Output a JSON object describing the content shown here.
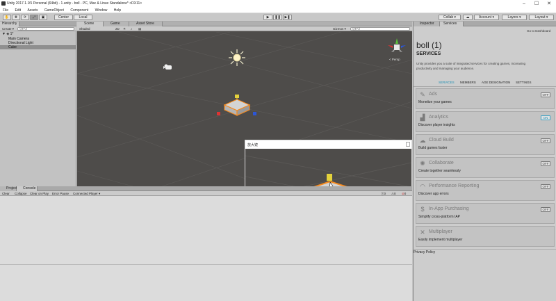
{
  "window": {
    "title": "Unity 2017.1.1f1 Personal (64bit) - 1.unity - boll - PC, Mac & Linux Standalone* <DX11>",
    "minimize": "–",
    "maximize": "☐",
    "close": "✕"
  },
  "menu": [
    "File",
    "Edit",
    "Assets",
    "GameObject",
    "Component",
    "Window",
    "Help"
  ],
  "toolbar": {
    "center": "Center",
    "local": "Local",
    "play": "▶",
    "pause": "❚❚",
    "step": "▶❚",
    "collab": "Collab ▾",
    "account": "Account ▾",
    "layers": "Layers ▾",
    "layout": "Layout ▾"
  },
  "hierarchy": {
    "tab": "Hierarchy",
    "create": "Create ▾",
    "search_placeholder": "Q▾All",
    "scene_name": "1*",
    "items": [
      "Main Camera",
      "Directional Light",
      "Cube"
    ]
  },
  "scene": {
    "tabs": [
      "Scene",
      "Game",
      "Asset Store"
    ],
    "shading": "Shaded",
    "mode2d": "2D",
    "gizmos": "Gizmos ▾",
    "search_placeholder": "Q▾All",
    "persp": "< Persp",
    "magnifier_title": "放大镜"
  },
  "console": {
    "tabs": [
      "Project",
      "Console"
    ],
    "buttons": [
      "Clear",
      "Collapse",
      "Clear on Play",
      "Error Pause",
      "Connected Player ▾"
    ],
    "counts": [
      "0",
      "0",
      "0"
    ]
  },
  "inspector": {
    "tabs": [
      "Inspector",
      "Services"
    ],
    "dashboard": "Go to Dashboard",
    "project_name": "boll (1)",
    "heading": "SERVICES",
    "intro_line1": "Unity provides you a suite of integrated services for creating games, increasing",
    "intro_line2": "productivity and managing your audience.",
    "subtabs": [
      "SERVICES",
      "MEMBERS",
      "AGE DESIGNATION",
      "SETTINGS"
    ],
    "services": [
      {
        "name": "Ads",
        "desc": "Monetize your games",
        "toggle": "OFF",
        "icon": "ads-icon",
        "glyph": "✎"
      },
      {
        "name": "Analytics",
        "desc": "Discover player insights",
        "toggle": "ON",
        "icon": "analytics-icon",
        "glyph": "▟"
      },
      {
        "name": "Cloud Build",
        "desc": "Build games faster",
        "toggle": "OFF",
        "icon": "cloud-icon",
        "glyph": "☁"
      },
      {
        "name": "Collaborate",
        "desc": "Create together seamlessly",
        "toggle": "OFF",
        "icon": "collaborate-icon",
        "glyph": "✺"
      },
      {
        "name": "Performance Reporting",
        "desc": "Discover app errors",
        "toggle": "OFF",
        "icon": "performance-icon",
        "glyph": "◠"
      },
      {
        "name": "In-App Purchasing",
        "desc": "Simplify cross-platform IAP",
        "toggle": "OFF",
        "icon": "purchasing-icon",
        "glyph": "$"
      },
      {
        "name": "Multiplayer",
        "desc": "Easily implement multiplayer",
        "toggle": "",
        "icon": "multiplayer-icon",
        "glyph": "✕"
      }
    ],
    "privacy": "Privacy Policy"
  },
  "colors": {
    "accent": "#1d8fb3",
    "scene_bg": "#4e4c4a",
    "cube_outline": "#f58a1f"
  }
}
